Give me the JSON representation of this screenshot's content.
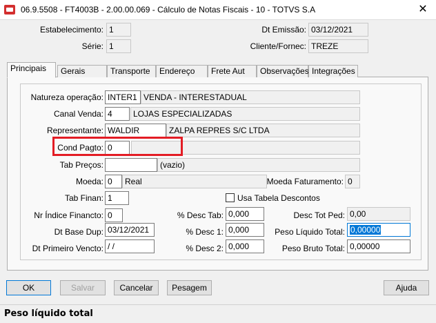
{
  "window": {
    "title": "06.9.5508 - FT4003B - 2.00.00.069 - Cálculo de Notas Fiscais - 10 - TOTVS S.A",
    "close": "✕"
  },
  "header": {
    "estabelecimento_label": "Estabelecimento:",
    "estabelecimento_value": "1",
    "serie_label": "Série:",
    "serie_value": "1",
    "dt_emissao_label": "Dt Emissão:",
    "dt_emissao_value": "03/12/2021",
    "cliente_label": "Cliente/Fornec:",
    "cliente_value": "TREZE"
  },
  "tabs": [
    "Principais",
    "Gerais",
    "Transporte",
    "Endereço",
    "Frete Aut",
    "Observações",
    "Integrações"
  ],
  "form": {
    "natureza_label": "Natureza operação:",
    "natureza_code": "INTER1",
    "natureza_desc": "VENDA - INTERESTADUAL",
    "canal_label": "Canal Venda:",
    "canal_code": "4",
    "canal_desc": "LOJAS ESPECIALIZADAS",
    "representante_label": "Representante:",
    "representante_code": "WALDIR",
    "representante_desc": "ZALPA REPRES S/C LTDA",
    "cond_pagto_label": "Cond Pagto:",
    "cond_pagto_value": "0",
    "cond_pagto_desc": "",
    "tab_precos_label": "Tab Preços:",
    "tab_precos_value": "",
    "tab_precos_desc": "(vazio)",
    "moeda_label": "Moeda:",
    "moeda_value": "0",
    "moeda_desc": "Real",
    "moeda_fat_label": "Moeda Faturamento:",
    "moeda_fat_value": "0",
    "tab_finan_label": "Tab Finan:",
    "tab_finan_value": "1",
    "usa_tabela_label": "Usa Tabela Descontos",
    "nr_indice_label": "Nr Índice Financto:",
    "nr_indice_value": "0",
    "desc_tab_label": "% Desc Tab:",
    "desc_tab_value": "0,000",
    "desc_tot_ped_label": "Desc Tot Ped:",
    "desc_tot_ped_value": "0,00",
    "dt_base_dup_label": "Dt Base Dup:",
    "dt_base_dup_value": "03/12/2021",
    "desc1_label": "% Desc 1:",
    "desc1_value": "0,000",
    "peso_liquido_label": "Peso Líquido Total:",
    "peso_liquido_value": "0,00000",
    "dt_primeiro_label": "Dt Primeiro Vencto:",
    "dt_primeiro_value": " /  /",
    "desc2_label": "% Desc 2:",
    "desc2_value": "0,000",
    "peso_bruto_label": "Peso Bruto Total:",
    "peso_bruto_value": "0,00000"
  },
  "buttons": {
    "ok": "OK",
    "salvar": "Salvar",
    "cancelar": "Cancelar",
    "pesagem": "Pesagem",
    "ajuda": "Ajuda"
  },
  "status": {
    "text": "Peso líquido total"
  },
  "colors": {
    "highlight": "#e31c24",
    "selection": "#0078d7"
  }
}
